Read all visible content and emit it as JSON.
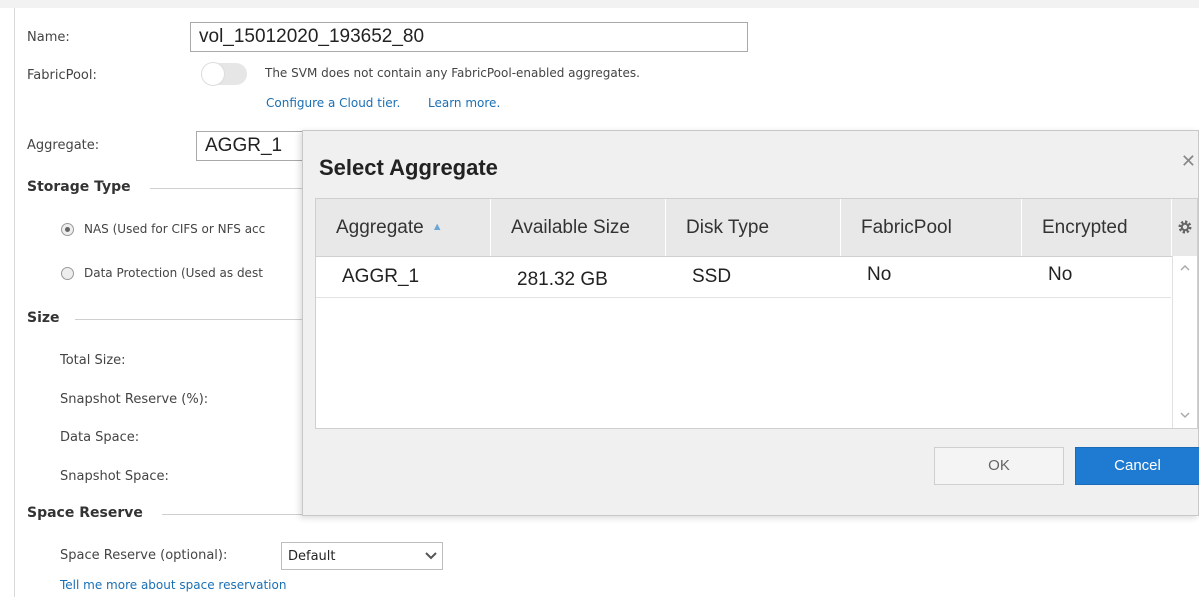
{
  "form": {
    "name_label": "Name:",
    "name_value": "vol_15012020_193652_80",
    "fabricpool_label": "FabricPool:",
    "fabricpool_message": "The SVM does not contain any FabricPool-enabled aggregates.",
    "configure_link": "Configure a Cloud tier.",
    "learn_more_link": "Learn more.",
    "aggregate_label": "Aggregate:",
    "aggregate_value": "AGGR_1",
    "storage_type_heading": "Storage Type",
    "storage_types": [
      {
        "label": "NAS (Used for CIFS or NFS acc",
        "selected": true
      },
      {
        "label": "Data Protection (Used as dest",
        "selected": false
      }
    ],
    "size_heading": "Size",
    "size_fields": [
      "Total Size:",
      "Snapshot Reserve (%):",
      "Data Space:",
      "Snapshot Space:"
    ],
    "space_reserve_heading": "Space Reserve",
    "space_reserve_label": "Space Reserve (optional):",
    "space_reserve_value": "Default",
    "space_reserve_link": "Tell me more about space reservation"
  },
  "dialog": {
    "title": "Select Aggregate",
    "close_glyph": "✕",
    "columns": [
      "Aggregate",
      "Available Size",
      "Disk Type",
      "FabricPool",
      "Encrypted"
    ],
    "sort_glyph": "▲",
    "rows": [
      {
        "aggregate": "AGGR_1",
        "available_size": "281.32 GB",
        "disk_type": "SSD",
        "fabricpool": "No",
        "encrypted": "No"
      }
    ],
    "ok_label": "OK",
    "cancel_label": "Cancel"
  },
  "icons": {
    "gear": "gear-icon",
    "close": "close-icon",
    "dropdown": "chevron-down-icon",
    "sort": "sort-ascending-icon"
  },
  "colors": {
    "link": "#1b6fb3",
    "primary_button": "#1f7bd1"
  }
}
